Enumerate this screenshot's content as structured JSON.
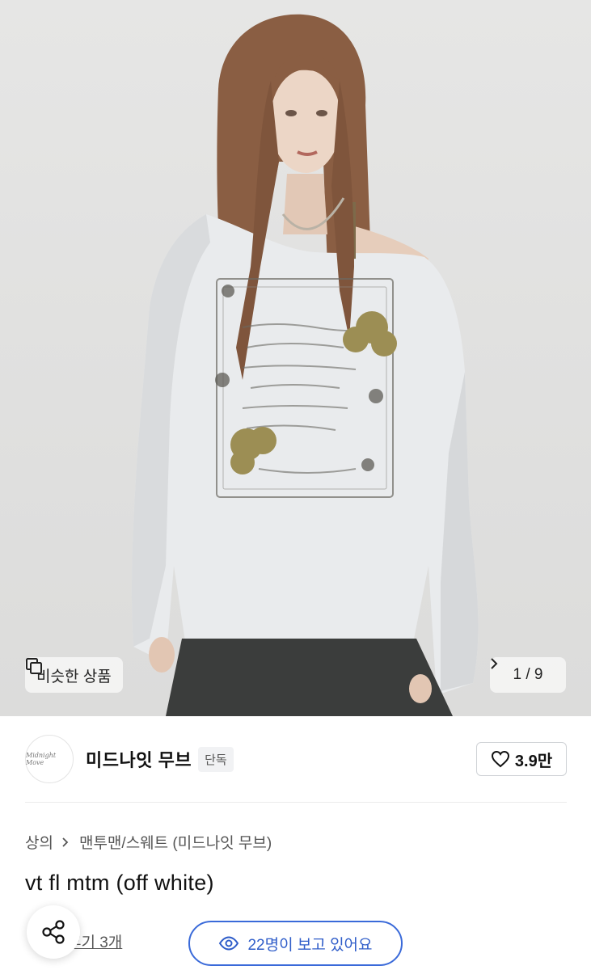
{
  "gallery": {
    "similar_label": "비슷한 상품",
    "counter": "1 / 9",
    "icons": {
      "similar": "similar-items-icon",
      "next": "chevron-right-icon"
    }
  },
  "shop": {
    "logo_text": "Midnight Move",
    "name": "미드나잇 무브",
    "badge": "단독",
    "likes": "3.9만",
    "like_icon": "heart-icon"
  },
  "breadcrumb": {
    "items": [
      "상의",
      "맨투맨/스웨트 (미드나잇 무브)"
    ]
  },
  "product": {
    "title": "vt fl mtm (off white)"
  },
  "footer": {
    "review_text": "후기 3개",
    "viewers": "22명이 보고 있어요",
    "accent_color": "#2f5dc9"
  }
}
